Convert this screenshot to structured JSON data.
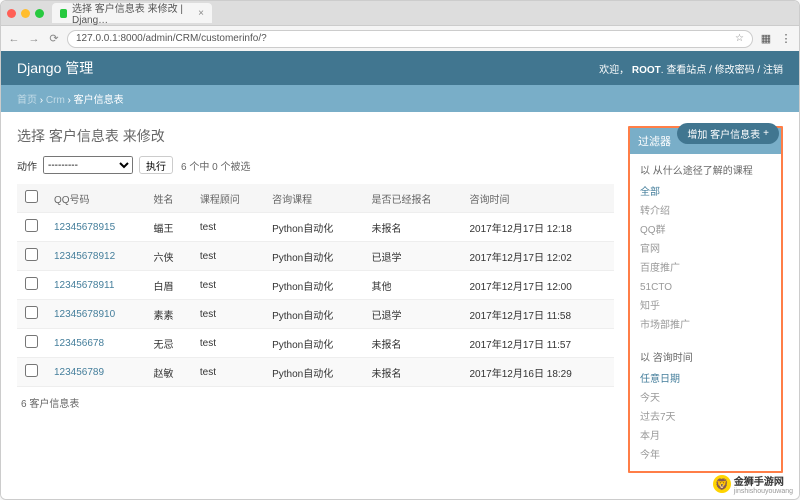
{
  "browser": {
    "tab_title": "选择 客户信息表 来修改 | Djang…",
    "url": "127.0.0.1:8000/admin/CRM/customerinfo/?"
  },
  "header": {
    "site_name": "Django 管理",
    "welcome": "欢迎，",
    "user": "ROOT",
    "links": {
      "view_site": "查看站点",
      "change_password": "修改密码",
      "logout": "注销"
    }
  },
  "breadcrumbs": {
    "home": "首页",
    "app": "Crm",
    "model": "客户信息表"
  },
  "page": {
    "title": "选择 客户信息表 来修改",
    "add_button": "增加 客户信息表",
    "action_label": "动作",
    "action_placeholder": "---------",
    "go_button": "执行",
    "selection_info": "6 个中 0 个被选",
    "result_count": "6 客户信息表"
  },
  "table": {
    "headers": [
      "QQ号码",
      "姓名",
      "课程顾问",
      "咨询课程",
      "是否已经报名",
      "咨询时间"
    ],
    "rows": [
      {
        "qq": "12345678915",
        "name": "蝠王",
        "advisor": "test",
        "course": "Python自动化",
        "signup": "未报名",
        "time": "2017年12月17日 12:18"
      },
      {
        "qq": "12345678912",
        "name": "六侠",
        "advisor": "test",
        "course": "Python自动化",
        "signup": "已退学",
        "time": "2017年12月17日 12:02"
      },
      {
        "qq": "12345678911",
        "name": "白眉",
        "advisor": "test",
        "course": "Python自动化",
        "signup": "其他",
        "time": "2017年12月17日 12:00"
      },
      {
        "qq": "12345678910",
        "name": "素素",
        "advisor": "test",
        "course": "Python自动化",
        "signup": "已退学",
        "time": "2017年12月17日 11:58"
      },
      {
        "qq": "123456678",
        "name": "无忌",
        "advisor": "test",
        "course": "Python自动化",
        "signup": "未报名",
        "time": "2017年12月17日 11:57"
      },
      {
        "qq": "123456789",
        "name": "赵敏",
        "advisor": "test",
        "course": "Python自动化",
        "signup": "未报名",
        "time": "2017年12月16日 18:29"
      }
    ]
  },
  "filters": {
    "title": "过滤器",
    "groups": [
      {
        "heading": "以 从什么途径了解的课程",
        "items": [
          "全部",
          "转介绍",
          "QQ群",
          "官网",
          "百度推广",
          "51CTO",
          "知乎",
          "市场部推广"
        ],
        "selected": 0
      },
      {
        "heading": "以 咨询时间",
        "items": [
          "任意日期",
          "今天",
          "过去7天",
          "本月",
          "今年"
        ],
        "selected": 0
      }
    ]
  },
  "watermark": {
    "cn": "金狮手游网",
    "en": "jinshishouyouwang"
  }
}
